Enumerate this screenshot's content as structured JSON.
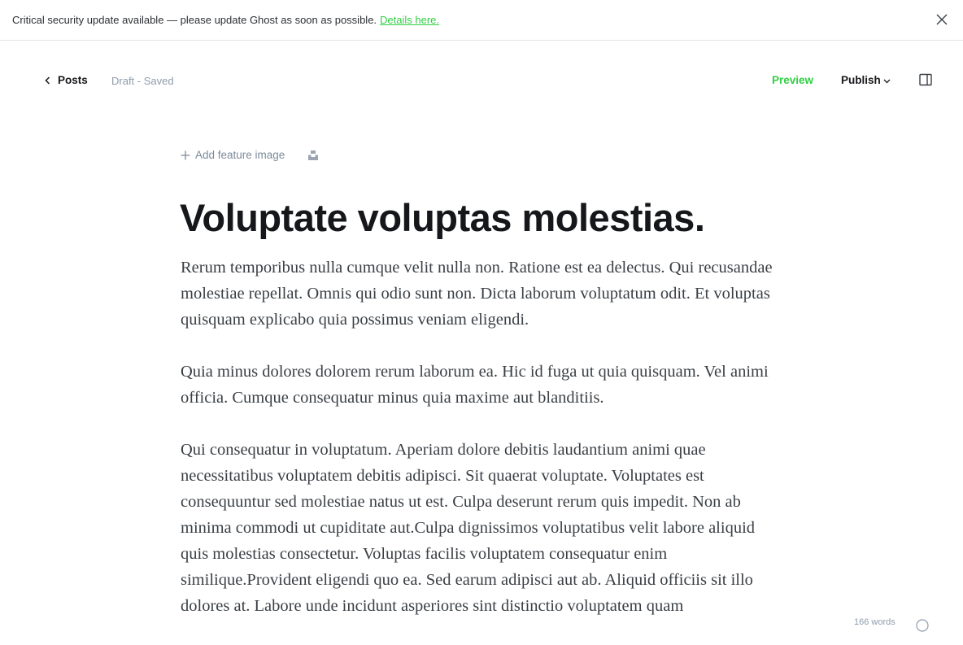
{
  "banner": {
    "message": "Critical security update available — please update Ghost as soon as possible.",
    "link_text": "Details here."
  },
  "topbar": {
    "back_label": "Posts",
    "status": "Draft - Saved",
    "preview_label": "Preview",
    "publish_label": "Publish"
  },
  "editor": {
    "add_feature_image": "Add feature image",
    "title": "Voluptate voluptas molestias.",
    "paragraphs": [
      "Rerum temporibus nulla cumque velit nulla non. Ratione est ea delectus. Qui recusandae molestiae repellat. Omnis qui odio sunt non. Dicta laborum voluptatum odit. Et voluptas quisquam explicabo quia possimus veniam eligendi.",
      "Quia minus dolores dolorem rerum laborum ea. Hic id fuga ut quia quisquam. Vel animi officia. Cumque consequatur minus quia maxime aut blanditiis.",
      "Qui consequatur in voluptatum. Aperiam dolore debitis laudantium animi quae necessitatibus voluptatem debitis adipisci. Sit quaerat voluptate. Voluptates est consequuntur sed molestiae natus ut est. Culpa deserunt rerum quis impedit. Non ab minima commodi ut cupiditate aut.Culpa dignissimos voluptatibus velit labore aliquid quis molestias consectetur. Voluptas facilis voluptatem consequatur enim similique.Provident eligendi quo ea. Sed earum adipisci aut ab. Aliquid officiis sit illo dolores at. Labore unde incidunt asperiores sint distinctio voluptatem quam"
    ],
    "word_count": "166 words"
  },
  "colors": {
    "accent": "#30cf43",
    "text": "#15171a",
    "muted": "#8e9cac"
  },
  "icons": {
    "close": "close-icon",
    "back": "chevron-left-icon",
    "publish_dropdown": "chevron-down-icon",
    "sidebar": "sidebar-panel-icon",
    "add": "plus-icon",
    "unsplash": "unsplash-icon",
    "help": "help-icon"
  }
}
